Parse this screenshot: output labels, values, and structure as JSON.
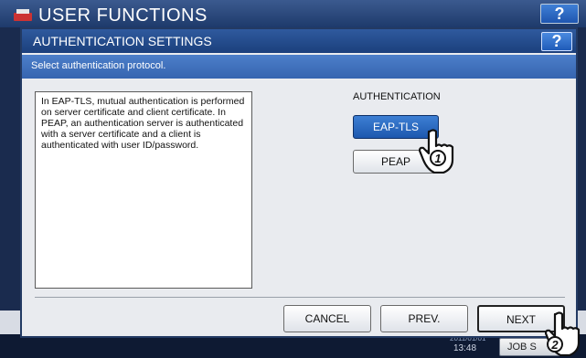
{
  "background": {
    "app_title": "USER FUNCTIONS",
    "help_label": "?",
    "status": {
      "time": "13:48",
      "date": "2011/01/01",
      "job_status_label": "JOB S"
    }
  },
  "dialog": {
    "title": "AUTHENTICATION SETTINGS",
    "help_label": "?",
    "instruction": "Select authentication protocol.",
    "description": "In EAP-TLS, mutual authentication is performed on server certificate and client certificate. In PEAP, an authentication server is authenticated with a server certificate and a client is authenticated with user ID/password.",
    "authentication": {
      "label": "AUTHENTICATION",
      "options": [
        {
          "label": "EAP-TLS",
          "selected": true
        },
        {
          "label": "PEAP",
          "selected": false
        }
      ]
    },
    "footer": {
      "cancel_label": "CANCEL",
      "prev_label": "PREV.",
      "next_label": "NEXT"
    }
  },
  "annotations": {
    "step1": "1",
    "step2": "2"
  },
  "colors": {
    "titlebar": "#1b3f7c",
    "instruction_bar": "#3665b0",
    "selected_button": "#1d58ae",
    "dialog_bg": "#e9ebef"
  }
}
